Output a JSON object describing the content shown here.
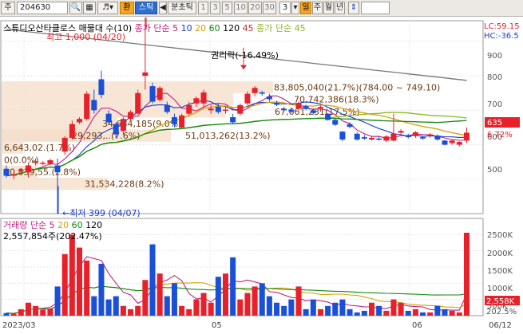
{
  "toolbar": {
    "market_label": "주",
    "code": "204630",
    "tab_won": "환",
    "tab_stick": "스틱",
    "nav_prev": "◀",
    "tick_label": "분초틱",
    "periods": [
      "1",
      "3",
      "5",
      "10",
      "20",
      "30"
    ],
    "period_value": "3",
    "day_label": "일",
    "week_label": "주",
    "month_label": "월",
    "year_label": "년"
  },
  "price_pane": {
    "title_parts": [
      {
        "text": "스튜디오산타클로스 매물대 수(10)",
        "color": "#000000"
      },
      {
        "text": "종가 단순 5",
        "color": "#c02080"
      },
      {
        "text": "10",
        "color": "#1a3ccc"
      },
      {
        "text": "20",
        "color": "#d8a000"
      },
      {
        "text": "60",
        "color": "#108810"
      },
      {
        "text": "120",
        "color": "#000000"
      },
      {
        "text": "45",
        "color": "#c03030"
      },
      {
        "text": "종가 단순 45",
        "color": "#8ab820"
      }
    ],
    "y_ticks": [
      "900",
      "800",
      "700",
      "600",
      "500"
    ],
    "lc_label": "LC:59.15",
    "hc_label": "HC:-36.5",
    "current_price": "635",
    "current_change": "6.72%",
    "high_annotation": "최고 1,000 (04/20)",
    "low_annotation": "←최저 399 (04/07)",
    "rights_annotation": "권리락(-16.49%)",
    "volume_profile": [
      {
        "value": "83,805,040(21.7%)(784.00 ~ 749.10)"
      },
      {
        "value": "70,742,386(18.3%)"
      },
      {
        "value": "67,661,231(17.5%)"
      },
      {
        "value": "51,013,262(13.2%)"
      },
      {
        "value": "34,684,185(9.0%)"
      },
      {
        "value": "29,293,..(7.6%)"
      },
      {
        "value": "6,643,02.(1.7%)"
      },
      {
        "value": "0(0.0%)"
      },
      {
        "value": "10,839,55.(2.8%)"
      },
      {
        "value": "31,534,228(8.2%)"
      }
    ]
  },
  "volume_pane": {
    "title_parts": [
      {
        "text": "거래량 단순 5",
        "color": "#c02080"
      },
      {
        "text": "20",
        "color": "#d8a000"
      },
      {
        "text": "60",
        "color": "#108810"
      },
      {
        "text": "120",
        "color": "#000000"
      }
    ],
    "max_label": "2,557,854주(202.47%)",
    "y_ticks": [
      "2500K",
      "2000K",
      "1500K",
      "1000K",
      "500K"
    ],
    "current_volume": "2,558K",
    "current_volume_pct": "202.5%"
  },
  "x_axis": {
    "ticks": [
      "2023/03",
      "05",
      "06",
      "06/12"
    ]
  },
  "colors": {
    "up": "#e8202a",
    "down": "#1a4fd8",
    "profile_fill": "#f4dcc8",
    "profile_text": "#6b3a10"
  },
  "chart_data": [
    {
      "type": "candlestick",
      "title": "스튜디오산타클로스",
      "ylim": [
        400,
        960
      ],
      "moving_averages": [
        "5",
        "10",
        "20",
        "60",
        "120",
        "45"
      ],
      "candles": [
        {
          "o": 530,
          "h": 540,
          "l": 505,
          "c": 510
        },
        {
          "o": 510,
          "h": 520,
          "l": 500,
          "c": 515
        },
        {
          "o": 525,
          "h": 532,
          "l": 515,
          "c": 528
        },
        {
          "o": 520,
          "h": 548,
          "l": 505,
          "c": 540
        },
        {
          "o": 548,
          "h": 560,
          "l": 540,
          "c": 552
        },
        {
          "o": 545,
          "h": 552,
          "l": 540,
          "c": 548
        },
        {
          "o": 545,
          "h": 560,
          "l": 540,
          "c": 555
        },
        {
          "o": 540,
          "h": 560,
          "l": 399,
          "c": 520
        },
        {
          "o": 580,
          "h": 625,
          "l": 570,
          "c": 620
        },
        {
          "o": 620,
          "h": 670,
          "l": 615,
          "c": 660
        },
        {
          "o": 665,
          "h": 680,
          "l": 660,
          "c": 675
        },
        {
          "o": 675,
          "h": 755,
          "l": 670,
          "c": 748
        },
        {
          "o": 730,
          "h": 760,
          "l": 690,
          "c": 700
        },
        {
          "o": 790,
          "h": 815,
          "l": 735,
          "c": 745
        },
        {
          "o": 690,
          "h": 700,
          "l": 660,
          "c": 665
        },
        {
          "o": 660,
          "h": 665,
          "l": 620,
          "c": 630
        },
        {
          "o": 640,
          "h": 680,
          "l": 630,
          "c": 675
        },
        {
          "o": 675,
          "h": 700,
          "l": 670,
          "c": 695
        },
        {
          "o": 690,
          "h": 760,
          "l": 690,
          "c": 750
        },
        {
          "o": 800,
          "h": 1000,
          "l": 760,
          "c": 810
        },
        {
          "o": 770,
          "h": 780,
          "l": 720,
          "c": 725
        },
        {
          "o": 730,
          "h": 770,
          "l": 725,
          "c": 765
        },
        {
          "o": 715,
          "h": 725,
          "l": 690,
          "c": 695
        },
        {
          "o": 680,
          "h": 690,
          "l": 650,
          "c": 660
        },
        {
          "o": 650,
          "h": 690,
          "l": 645,
          "c": 685
        },
        {
          "o": 690,
          "h": 725,
          "l": 685,
          "c": 715
        },
        {
          "o": 720,
          "h": 740,
          "l": 710,
          "c": 735
        },
        {
          "o": 720,
          "h": 760,
          "l": 710,
          "c": 752
        },
        {
          "o": 700,
          "h": 715,
          "l": 690,
          "c": 705
        },
        {
          "o": 710,
          "h": 720,
          "l": 690,
          "c": 695
        },
        {
          "o": 700,
          "h": 710,
          "l": 690,
          "c": 702
        },
        {
          "o": 680,
          "h": 690,
          "l": 660,
          "c": 665
        },
        {
          "o": 690,
          "h": 720,
          "l": 685,
          "c": 715
        },
        {
          "o": 720,
          "h": 755,
          "l": 715,
          "c": 748
        },
        {
          "o": 750,
          "h": 770,
          "l": 740,
          "c": 765
        },
        {
          "o": 752,
          "h": 757,
          "l": 742,
          "c": 748
        },
        {
          "o": 740,
          "h": 748,
          "l": 725,
          "c": 732
        },
        {
          "o": 722,
          "h": 728,
          "l": 712,
          "c": 716
        },
        {
          "o": 704,
          "h": 710,
          "l": 696,
          "c": 700
        },
        {
          "o": 702,
          "h": 708,
          "l": 692,
          "c": 696
        },
        {
          "o": 705,
          "h": 725,
          "l": 700,
          "c": 720
        },
        {
          "o": 712,
          "h": 716,
          "l": 700,
          "c": 704
        },
        {
          "o": 700,
          "h": 706,
          "l": 688,
          "c": 692
        },
        {
          "o": 706,
          "h": 714,
          "l": 696,
          "c": 710
        },
        {
          "o": 690,
          "h": 692,
          "l": 670,
          "c": 672
        },
        {
          "o": 672,
          "h": 676,
          "l": 655,
          "c": 658
        },
        {
          "o": 638,
          "h": 640,
          "l": 610,
          "c": 615
        },
        {
          "o": 660,
          "h": 665,
          "l": 648,
          "c": 652
        },
        {
          "o": 632,
          "h": 636,
          "l": 612,
          "c": 615
        },
        {
          "o": 622,
          "h": 628,
          "l": 614,
          "c": 618
        },
        {
          "o": 615,
          "h": 625,
          "l": 612,
          "c": 620
        },
        {
          "o": 618,
          "h": 624,
          "l": 612,
          "c": 616
        },
        {
          "o": 612,
          "h": 628,
          "l": 608,
          "c": 624
        },
        {
          "o": 612,
          "h": 690,
          "l": 610,
          "c": 632
        },
        {
          "o": 635,
          "h": 645,
          "l": 630,
          "c": 640
        },
        {
          "o": 628,
          "h": 632,
          "l": 618,
          "c": 622
        },
        {
          "o": 625,
          "h": 640,
          "l": 620,
          "c": 636
        },
        {
          "o": 622,
          "h": 625,
          "l": 614,
          "c": 618
        },
        {
          "o": 628,
          "h": 634,
          "l": 620,
          "c": 630
        },
        {
          "o": 626,
          "h": 630,
          "l": 612,
          "c": 615
        },
        {
          "o": 612,
          "h": 615,
          "l": 598,
          "c": 600
        },
        {
          "o": 605,
          "h": 615,
          "l": 600,
          "c": 612
        },
        {
          "o": 600,
          "h": 610,
          "l": 595,
          "c": 608
        },
        {
          "o": 612,
          "h": 650,
          "l": 605,
          "c": 635
        }
      ]
    },
    {
      "type": "bar",
      "title": "거래량",
      "ylim": [
        0,
        3000
      ],
      "unit": "K",
      "values": [
        80,
        60,
        200,
        400,
        300,
        180,
        220,
        900,
        1900,
        2500,
        2100,
        1700,
        600,
        1600,
        500,
        600,
        300,
        200,
        300,
        1100,
        2200,
        1300,
        600,
        1000,
        300,
        200,
        500,
        700,
        400,
        1200,
        1300,
        1800,
        500,
        700,
        900,
        1000,
        600,
        400,
        300,
        500,
        900,
        200,
        500,
        200,
        300,
        400,
        500,
        200,
        100,
        150,
        400,
        300,
        150,
        500,
        400,
        150,
        200,
        100,
        100,
        300,
        200,
        150,
        100,
        2558
      ]
    }
  ]
}
